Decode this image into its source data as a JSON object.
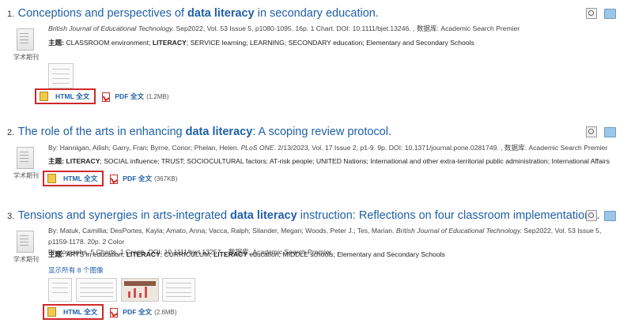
{
  "results": [
    {
      "num": "1.",
      "title_pre": "Conceptions and perspectives of ",
      "title_bold": "data literacy",
      "title_post": " in secondary education.",
      "meta_journal": "British Journal of Educational Technology.",
      "meta_rest": " Sep2022, Vol. 53 Issue 5, p1080-1095. 16p. 1 Chart. DOI: 10.1111/bjet.13246. , 数据库: Academic Search Premier",
      "subjects_head": "主题:",
      "subjects_text": " CLASSROOM environment; LITERACY; SERVICE learning; LEARNING; SECONDARY education; Elementary and Secondary Schools",
      "type_label": "学术期刊",
      "html_label": "HTML 全文",
      "pdf_label": "PDF 全文",
      "pdf_size": "(1.2MB)"
    },
    {
      "num": "2.",
      "title_pre": "The role of the arts in enhancing ",
      "title_bold": "data literacy",
      "title_post": ": A scoping review protocol.",
      "meta_authors": "By: Hannigan, Ailish; Garry, Fran; Byrne, Conor; Phelan, Helen. ",
      "meta_journal": "PLoS ONE.",
      "meta_rest": " 2/13/2023, Vol. 17 Issue 2, p1-9. 9p. DOI: 10.1371/journal.pone.0281749. , 数据库: Academic Search Premier",
      "subjects_head": "主题:",
      "subjects_text": " LITERACY; SOCIAL influence; TRUST; SOCIOCULTURAL factors; AT-risk people; UNITED Nations; International and other extra-territorial public administration; International Affairs",
      "type_label": "学术期刊",
      "html_label": "HTML 全文",
      "pdf_label": "PDF 全文",
      "pdf_size": "(367KB)"
    },
    {
      "num": "3.",
      "title_pre": "Tensions and synergies in arts-integrated ",
      "title_bold": "data literacy",
      "title_post": " instruction: Reflections on four classroom implementations.",
      "meta_authors": "By: Matuk, Camillia; DesPortes, Kayla; Amato, Anna; Vacca, Ralph; Silander, Megan; Woods, Peter J.; Tes, Marian. ",
      "meta_journal": "British Journal of Educational Technology.",
      "meta_rest_line1": " Sep2022, Vol. 53 Issue 5, p1159-1178. 20p. 2 Color",
      "meta_rest_line2": "Photographs, 5 Charts, 1 Graph. DOI: 10.1111/bjet.13257. , 数据库: Academic Search Premier",
      "subjects_head": "主题:",
      "subjects_text": " ARTS in education; LITERACY; CURRICULUM; LITERACY education; MIDDLE schools; Elementary and Secondary Schools",
      "images_link": "显示所有 8 个图像",
      "type_label": "学术期刊",
      "html_label": "HTML 全文",
      "pdf_label": "PDF 全文",
      "pdf_size": "(2.6MB)"
    }
  ],
  "icons": {
    "preview": "magnifier-icon",
    "folder": "folder-icon",
    "document": "journal-document-icon",
    "html": "html-fulltext-icon",
    "pdf": "pdf-icon"
  },
  "colors": {
    "link": "#1f5fa8",
    "highlight_border": "#d0282a"
  }
}
